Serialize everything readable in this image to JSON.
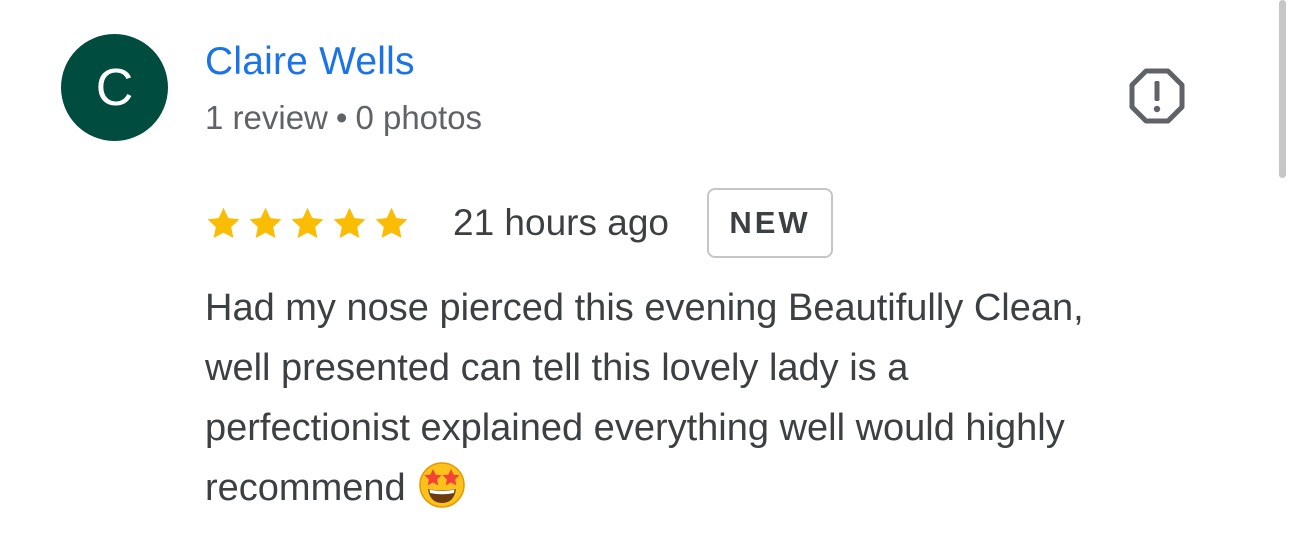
{
  "reviewer": {
    "initial": "C",
    "name": "Claire Wells",
    "review_count": "1 review",
    "separator": "•",
    "photo_count": "0 photos",
    "avatar_color": "#004d40",
    "name_color": "#1a73e8"
  },
  "review": {
    "rating": 5,
    "rating_max": 5,
    "star_color": "#fbbc04",
    "time": "21 hours ago",
    "badge": "NEW",
    "text_lines": [
      "Had my nose pierced this evening Beautifully Clean,",
      "well presented can tell this lovely lady is a",
      "perfectionist explained everything well would highly",
      "recommend"
    ],
    "emoji": "star-struck-emoji"
  },
  "icons": {
    "report": "report-octagon-icon",
    "star": "star-icon"
  }
}
